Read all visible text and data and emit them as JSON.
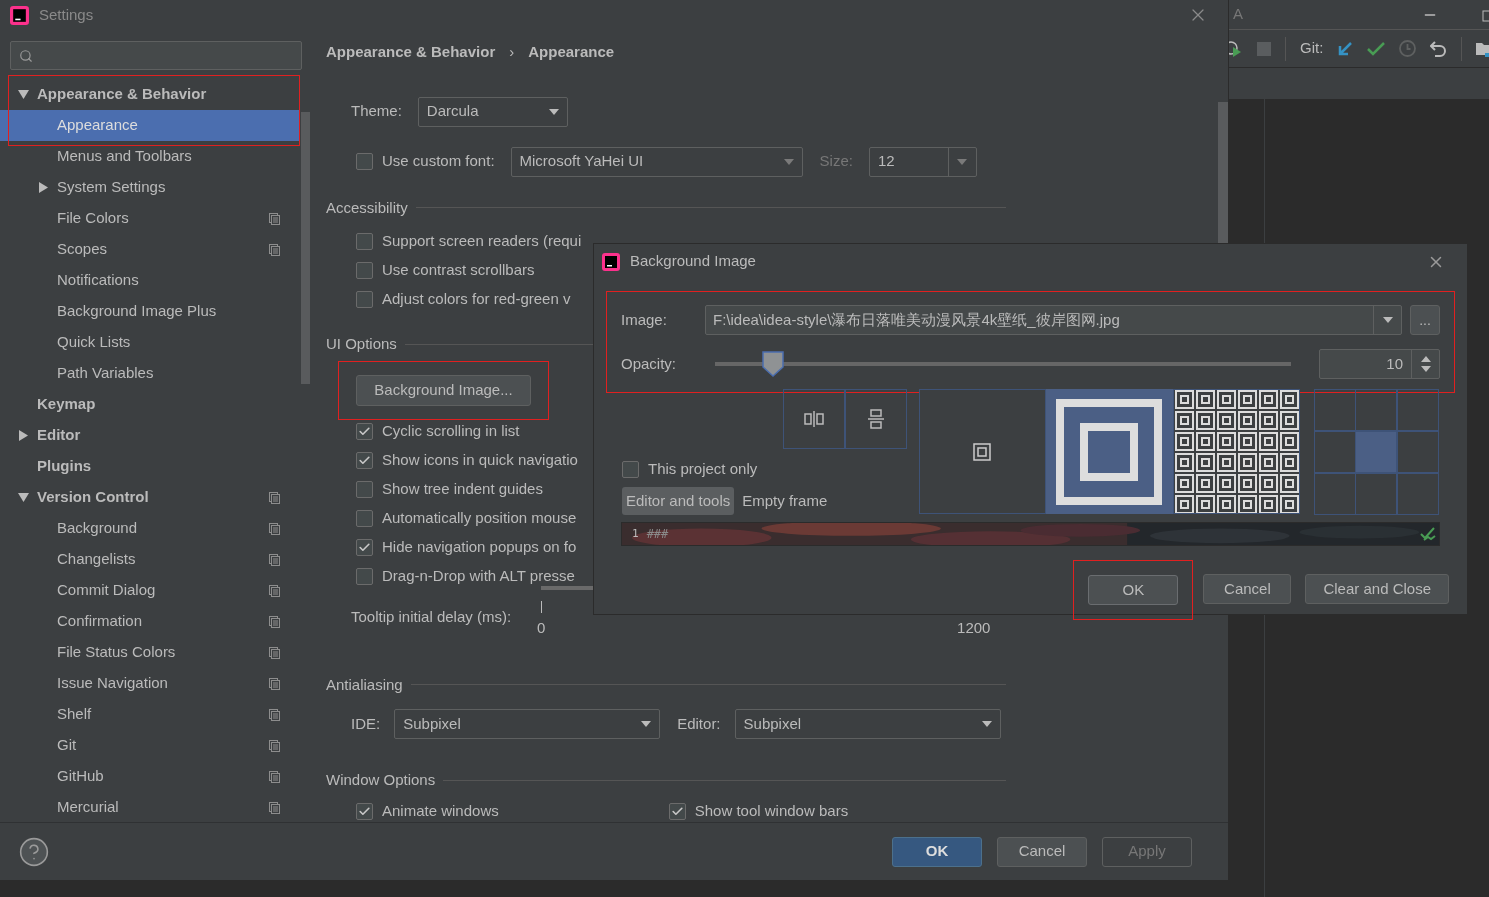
{
  "window": {
    "title": "Settings"
  },
  "sidebar": {
    "annotated": true,
    "items": [
      {
        "label": "Appearance & Behavior",
        "bold": true,
        "expanded": true,
        "selected": false,
        "project_level": false,
        "children": [
          {
            "label": "Appearance",
            "selected": true,
            "project_level": false
          },
          {
            "label": "Menus and Toolbars",
            "selected": false,
            "project_level": false
          },
          {
            "label": "System Settings",
            "expanded": false,
            "selected": false,
            "project_level": false
          },
          {
            "label": "File Colors",
            "selected": false,
            "project_level": true
          },
          {
            "label": "Scopes",
            "selected": false,
            "project_level": true
          },
          {
            "label": "Notifications",
            "selected": false,
            "project_level": false
          },
          {
            "label": "Background Image Plus",
            "selected": false,
            "project_level": false
          },
          {
            "label": "Quick Lists",
            "selected": false,
            "project_level": false
          },
          {
            "label": "Path Variables",
            "selected": false,
            "project_level": false
          }
        ]
      },
      {
        "label": "Keymap",
        "bold": true,
        "selected": false,
        "project_level": false
      },
      {
        "label": "Editor",
        "bold": true,
        "expanded": false,
        "selected": false,
        "project_level": false
      },
      {
        "label": "Plugins",
        "bold": true,
        "selected": false,
        "project_level": false
      },
      {
        "label": "Version Control",
        "bold": true,
        "expanded": true,
        "selected": false,
        "project_level": true,
        "children": [
          {
            "label": "Background",
            "selected": false,
            "project_level": true
          },
          {
            "label": "Changelists",
            "selected": false,
            "project_level": true
          },
          {
            "label": "Commit Dialog",
            "selected": false,
            "project_level": true
          },
          {
            "label": "Confirmation",
            "selected": false,
            "project_level": true
          },
          {
            "label": "File Status Colors",
            "selected": false,
            "project_level": true
          },
          {
            "label": "Issue Navigation",
            "selected": false,
            "project_level": true
          },
          {
            "label": "Shelf",
            "selected": false,
            "project_level": true
          },
          {
            "label": "Git",
            "selected": false,
            "project_level": true
          },
          {
            "label": "GitHub",
            "selected": false,
            "project_level": true
          },
          {
            "label": "Mercurial",
            "selected": false,
            "project_level": true
          }
        ]
      }
    ]
  },
  "breadcrumb": {
    "items": [
      "Appearance & Behavior",
      "Appearance"
    ],
    "separator": "›"
  },
  "theme": {
    "label": "Theme:",
    "value": "Darcula"
  },
  "custom_font": {
    "label": "Use custom font:",
    "checked": false,
    "font": "Microsoft YaHei UI",
    "size_label": "Size:",
    "size": "12"
  },
  "accessibility": {
    "title": "Accessibility",
    "options": [
      {
        "label": "Support screen readers (requi",
        "checked": false
      },
      {
        "label": "Use contrast scrollbars",
        "checked": false
      },
      {
        "label": "Adjust colors for red-green v",
        "checked": false
      }
    ]
  },
  "ui_options": {
    "title": "UI Options",
    "button": {
      "label": "Background Image...",
      "highlighted": true
    },
    "options": [
      {
        "label": "Cyclic scrolling in list",
        "checked": true
      },
      {
        "label": "Show icons in quick navigatio",
        "checked": true
      },
      {
        "label": "Show tree indent guides",
        "checked": false
      },
      {
        "label": "Automatically position mouse",
        "checked": false
      },
      {
        "label": "Hide navigation popups on fo",
        "checked": true
      },
      {
        "label": "Drag-n-Drop with ALT presse",
        "checked": false
      }
    ],
    "tooltip": {
      "label": "Tooltip initial delay (ms):",
      "min": "0",
      "max": "1200"
    }
  },
  "antialiasing": {
    "title": "Antialiasing",
    "ide_label": "IDE:",
    "ide": "Subpixel",
    "editor_label": "Editor:",
    "editor": "Subpixel"
  },
  "window_options": {
    "title": "Window Options",
    "options": [
      {
        "label": "Animate windows",
        "checked": true
      },
      {
        "label": "Show tool window bars",
        "checked": true
      }
    ]
  },
  "footer": {
    "buttons": [
      {
        "label": "OK",
        "kind": "primary"
      },
      {
        "label": "Cancel",
        "kind": "normal"
      },
      {
        "label": "Apply",
        "kind": "disabled"
      }
    ]
  },
  "ide": {
    "title": "A",
    "git_label": "Git:"
  },
  "dialog": {
    "title": "Background Image",
    "highlighted": true,
    "image_label": "Image:",
    "image_path": "F:\\idea\\idea-style\\瀑布日落唯美动漫风景4k壁纸_彼岸图网.jpg",
    "browse": "...",
    "opacity_label": "Opacity:",
    "opacity": {
      "level": 0.1
    },
    "opacity_value": "10",
    "project_only": {
      "label": "This project only",
      "checked": false
    },
    "targets": [
      {
        "label": "Editor and tools",
        "selected": true
      },
      {
        "label": "Empty frame",
        "selected": false
      }
    ],
    "fill_modes": [
      {
        "kind": "center",
        "selected": false
      },
      {
        "kind": "scale",
        "selected": true
      },
      {
        "kind": "tile",
        "selected": false
      }
    ],
    "anchors": [
      {
        "selected": false
      },
      {
        "selected": false
      },
      {
        "selected": false
      },
      {
        "selected": false
      },
      {
        "selected": true
      },
      {
        "selected": false
      },
      {
        "selected": false
      },
      {
        "selected": false
      },
      {
        "selected": false
      }
    ],
    "preview": {
      "line_number": "1",
      "text": "###"
    },
    "buttons": [
      {
        "label": "OK",
        "kind": "default",
        "highlighted": true
      },
      {
        "label": "Cancel",
        "kind": "normal",
        "highlighted": false
      },
      {
        "label": "Clear and Close",
        "kind": "normal",
        "highlighted": false
      }
    ]
  }
}
